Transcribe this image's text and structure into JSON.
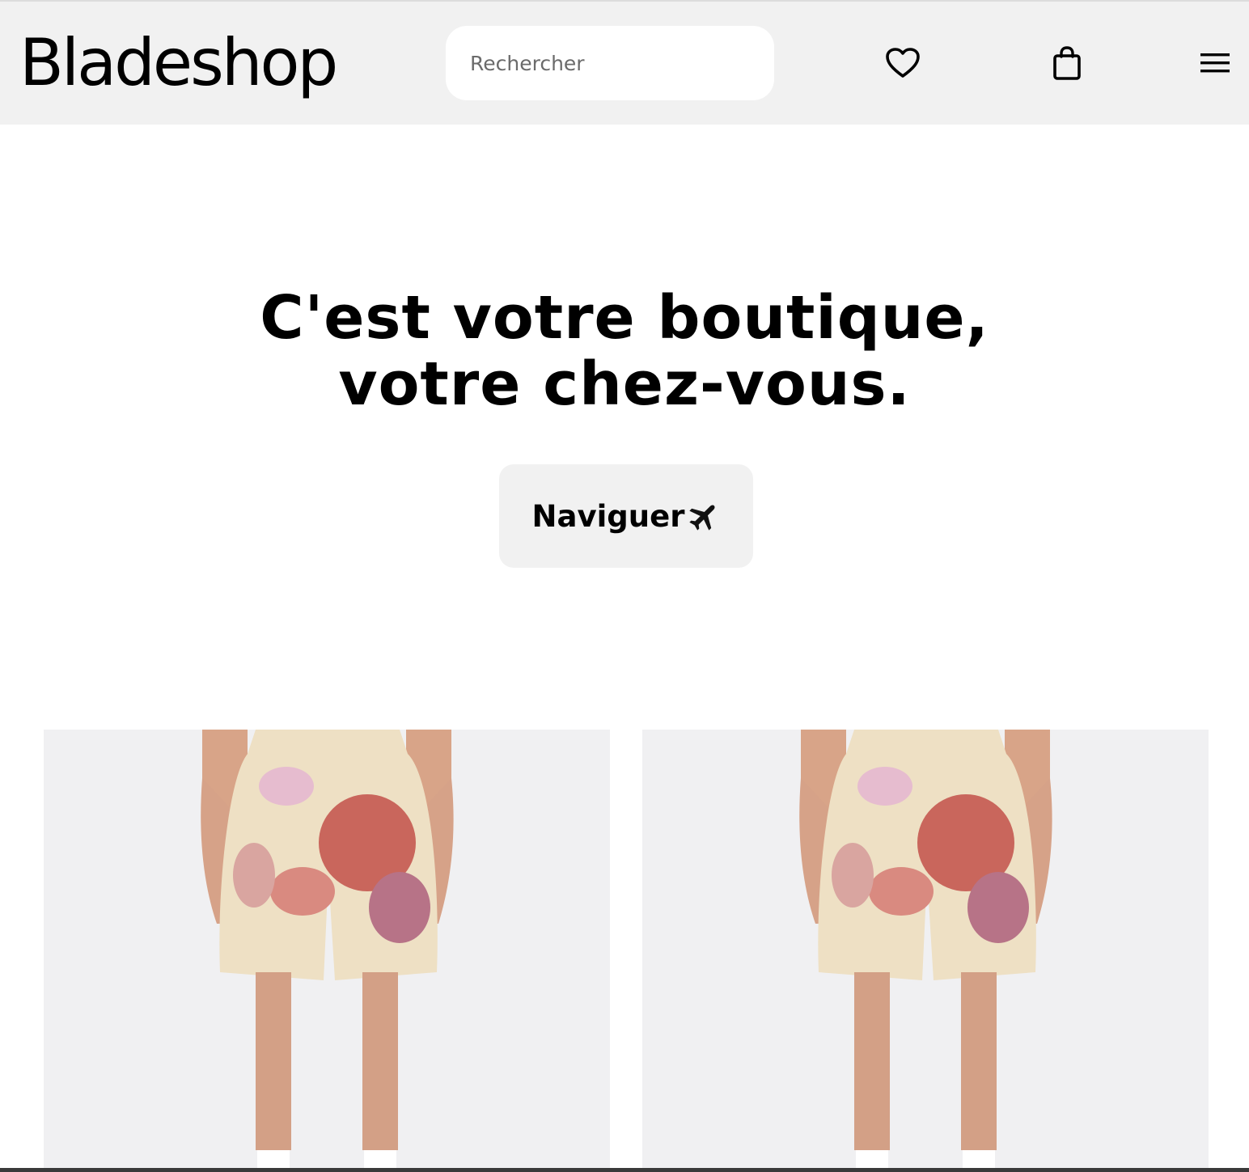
{
  "brand": {
    "name": "Bladeshop"
  },
  "search": {
    "placeholder": "Rechercher",
    "value": ""
  },
  "header_icons": [
    "heart-icon",
    "shopping-bag-icon",
    "hamburger-menu-icon"
  ],
  "hero": {
    "title_line1": "C'est votre boutique,",
    "title_line2": "votre chez-vous.",
    "cta_label": "Naviguer",
    "cta_icon": "airplane-icon"
  },
  "products": [
    {
      "image": "tie-dye-shorts"
    },
    {
      "image": "tie-dye-shorts"
    }
  ],
  "colors": {
    "header_bg": "#f1f1f1",
    "cta_bg": "#f1f1f1",
    "product_bg": "#f0f0f2",
    "text": "#000000"
  }
}
